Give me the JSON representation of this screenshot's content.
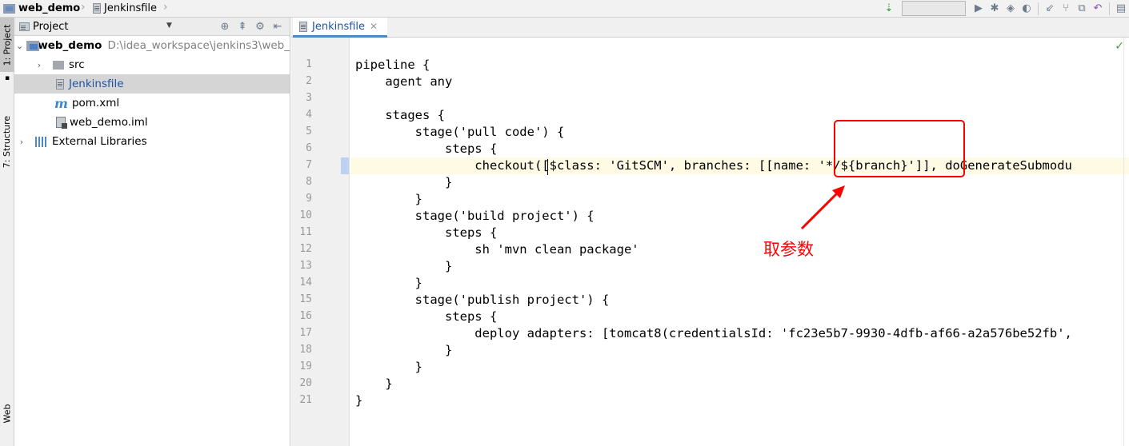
{
  "breadcrumb": {
    "project": "web_demo",
    "file": "Jenkinsfile"
  },
  "tool_strip": {
    "project_tab": "1: Project",
    "structure_tab": "7: Structure",
    "web_tab": "Web"
  },
  "project_panel": {
    "title": "Project",
    "items": [
      {
        "label": "web_demo",
        "path": "D:\\idea_workspace\\jenkins3\\web_"
      },
      {
        "label": "src"
      },
      {
        "label": "Jenkinsfile"
      },
      {
        "label": "pom.xml"
      },
      {
        "label": "web_demo.iml"
      },
      {
        "label": "External Libraries"
      }
    ]
  },
  "editor": {
    "tab_label": "Jenkinsfile",
    "line_numbers": [
      "1",
      "2",
      "3",
      "4",
      "5",
      "6",
      "7",
      "8",
      "9",
      "10",
      "11",
      "12",
      "13",
      "14",
      "15",
      "16",
      "17",
      "18",
      "19",
      "20",
      "21"
    ],
    "lines": [
      "pipeline {",
      "    agent any",
      "",
      "    stages {",
      "        stage('pull code') {",
      "            steps {",
      "                checkout([$class: 'GitSCM', branches: [[name: '*/${branch}']], doGenerateSubmodu",
      "            }",
      "        }",
      "        stage('build project') {",
      "            steps {",
      "                sh 'mvn clean package'",
      "            }",
      "        }",
      "        stage('publish project') {",
      "            steps {",
      "                deploy adapters: [tomcat8(credentialsId: 'fc23e5b7-9930-4dfb-af66-a2a576be52fb',",
      "            }",
      "        }",
      "    }",
      "}"
    ]
  },
  "annotation": {
    "text": "取参数"
  },
  "colors": {
    "accent": "#4a88c7",
    "annotation": "#ff0000",
    "current_line": "#fffae3"
  }
}
